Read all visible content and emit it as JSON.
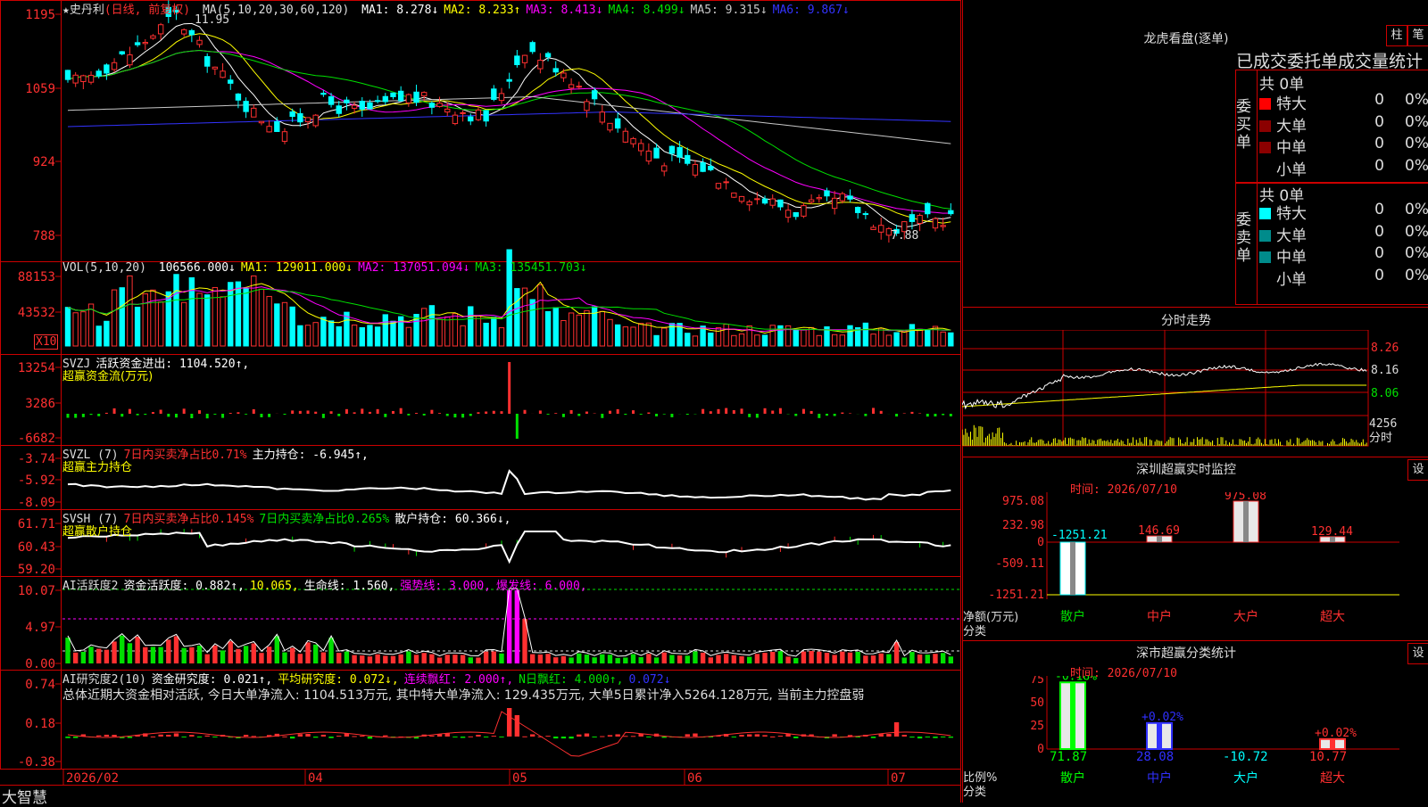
{
  "main": {
    "stock_name": "★史丹利",
    "period": "(日线, 前复权)",
    "ma_params": "MA(5,10,20,30,60,120)",
    "ma_values": [
      {
        "label": "MA1: 8.278↓",
        "color": "#ffffff"
      },
      {
        "label": "MA2: 8.233↑",
        "color": "#ffff00"
      },
      {
        "label": "MA3: 8.413↓",
        "color": "#ff00ff"
      },
      {
        "label": "MA4: 8.499↓",
        "color": "#00e000"
      },
      {
        "label": "MA5: 9.315↓",
        "color": "#c8c8c8"
      },
      {
        "label": "MA6: 9.867↓",
        "color": "#3333ff"
      }
    ],
    "yticks": [
      "1195",
      "1059",
      "924",
      "788"
    ],
    "high_label": "11.95",
    "low_label": "7.88"
  },
  "vol": {
    "label": "VOL(5,10,20)",
    "values": [
      {
        "label": "106566.000↓",
        "color": "#ffffff"
      },
      {
        "label": "MA1: 129011.000↓",
        "color": "#ffff00"
      },
      {
        "label": "MA2: 137051.094↓",
        "color": "#ff00ff"
      },
      {
        "label": "MA3: 135451.703↓",
        "color": "#00e000"
      }
    ],
    "yticks": [
      "88153",
      "43532"
    ],
    "unit": "X10"
  },
  "svzj": {
    "line1": [
      {
        "label": "SVZJ",
        "color": "#ddd"
      },
      {
        "label": "活跃资金进出: 1104.520↑,",
        "color": "#ffffff"
      }
    ],
    "line2": "超赢资金流(万元)",
    "yticks": [
      "13254",
      "3286",
      "-6682"
    ]
  },
  "svzl": {
    "line1": [
      {
        "label": "SVZL (7)",
        "color": "#ddd"
      },
      {
        "label": "7日内买卖净占比0.71%",
        "color": "#ff3030"
      },
      {
        "label": "主力持仓: -6.945↑,",
        "color": "#ffffff"
      }
    ],
    "line2": "超赢主力持仓",
    "yticks": [
      "-3.74",
      "-5.92",
      "-8.09"
    ]
  },
  "svsh": {
    "line1": [
      {
        "label": "SVSH (7)",
        "color": "#ddd"
      },
      {
        "label": "7日内买卖净占比0.145%",
        "color": "#ff3030"
      },
      {
        "label": "7日内买卖净占比0.265%",
        "color": "#00e000"
      },
      {
        "label": "散户持仓: 60.366↓,",
        "color": "#ffffff"
      }
    ],
    "line2": "超赢散户持仓",
    "yticks": [
      "61.71",
      "60.43",
      "59.20"
    ]
  },
  "ai1": {
    "line1": [
      {
        "label": "AI活跃度2",
        "color": "#ddd"
      },
      {
        "label": "资金活跃度: 0.882↑,",
        "color": "#ffffff"
      },
      {
        "label": "10.065,",
        "color": "#ffff00"
      },
      {
        "label": "生命线: 1.560,",
        "color": "#ffffff"
      },
      {
        "label": "强势线: 3.000,",
        "color": "#ff00ff"
      },
      {
        "label": "爆发线: 6.000,",
        "color": "#ff00ff"
      }
    ],
    "yticks": [
      "10.07",
      "4.97",
      "0.00"
    ]
  },
  "ai2": {
    "line1": [
      {
        "label": "AI研究度2(10)",
        "color": "#ddd"
      },
      {
        "label": "资金研究度: 0.021↑,",
        "color": "#ffffff"
      },
      {
        "label": "平均研究度: 0.072↓,",
        "color": "#ffff00"
      },
      {
        "label": "连续飘红: 2.000↑,",
        "color": "#ff00ff"
      },
      {
        "label": "N日飘红: 4.000↑,",
        "color": "#00e000"
      },
      {
        "label": "0.072↓",
        "color": "#3333ff"
      }
    ],
    "summary": "总体近期大资金相对活跃, 今日大单净流入: 1104.513万元, 其中特大单净流入: 129.435万元, 大单5日累计净入5264.128万元, 当前主力控盘弱",
    "yticks": [
      "0.74",
      "0.18",
      "-0.38"
    ]
  },
  "xaxis": {
    "app_name": "大智慧",
    "labels": [
      "2026/02",
      "04",
      "05",
      "06",
      "07"
    ]
  },
  "longhu": {
    "title": "龙虎看盘(逐单)",
    "btn1": "柱",
    "btn2": "笔",
    "subtitle": "已成交委托单成交量统计",
    "buy": {
      "side_label": "委买单",
      "total": "共 0单",
      "rows": [
        {
          "name": "特大",
          "count": "0",
          "pct": "0%",
          "color": "#ff0000"
        },
        {
          "name": "大单",
          "count": "0",
          "pct": "0%",
          "color": "#8b0000"
        },
        {
          "name": "中单",
          "count": "0",
          "pct": "0%",
          "color": "#8b0000"
        },
        {
          "name": "小单",
          "count": "0",
          "pct": "0%",
          "color": "#000000"
        }
      ]
    },
    "sell": {
      "side_label": "委卖单",
      "total": "共 0单",
      "rows": [
        {
          "name": "特大",
          "count": "0",
          "pct": "0%",
          "color": "#00ffff"
        },
        {
          "name": "大单",
          "count": "0",
          "pct": "0%",
          "color": "#008b8b"
        },
        {
          "name": "中单",
          "count": "0",
          "pct": "0%",
          "color": "#008b8b"
        },
        {
          "name": "小单",
          "count": "0",
          "pct": "0%",
          "color": "#000000"
        }
      ]
    }
  },
  "intraday": {
    "title": "分时走势",
    "prices": [
      "8.26",
      "8.16",
      "8.06"
    ],
    "volume": "4256",
    "unit": "分时"
  },
  "sz_monitor": {
    "title": "深圳超赢实时监控",
    "set_btn": "设",
    "time": "时间: 2026/07/10",
    "yticks": [
      "975.08",
      "232.98",
      "0",
      "-509.11",
      "-1251.21"
    ],
    "ylabel": "净额(万元)",
    "xlabel": "分类",
    "bars": [
      {
        "cat": "散户",
        "value": -1251.21,
        "label": "-1251.21",
        "color": "#00ffff"
      },
      {
        "cat": "中户",
        "value": 146.69,
        "label": "146.69",
        "color": "#ff3030"
      },
      {
        "cat": "大户",
        "value": 975.08,
        "label": "975.08",
        "color": "#ff3030"
      },
      {
        "cat": "超大",
        "value": 129.44,
        "label": "129.44",
        "color": "#ff3030"
      }
    ]
  },
  "sz_class": {
    "title": "深市超赢分类统计",
    "set_btn": "设",
    "time": "时间: 2026/07/10",
    "yticks": [
      "75",
      "50",
      "25",
      "0"
    ],
    "ylabel": "比例%",
    "xlabel": "分类",
    "bars": [
      {
        "cat": "散户",
        "value": 71.87,
        "label": "71.87",
        "top": "-0.18%",
        "color": "#00ff00",
        "labelcolor": "#00ff00"
      },
      {
        "cat": "中户",
        "value": 28.08,
        "label": "28.08",
        "top": "+0.02%",
        "color": "#3030ff",
        "labelcolor": "#3030ff"
      },
      {
        "cat": "大户",
        "value": -10.72,
        "label": "-10.72",
        "top": "",
        "color": "#00ffff",
        "labelcolor": "#00ffff"
      },
      {
        "cat": "超大",
        "value": 10.77,
        "label": "10.77",
        "top": "+0.02%",
        "color": "#ff3030",
        "labelcolor": "#ff3030"
      }
    ]
  }
}
